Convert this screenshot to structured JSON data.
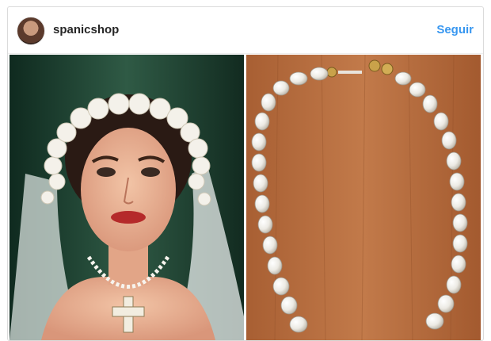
{
  "post": {
    "username": "spanicshop",
    "follow_label": "Seguir"
  },
  "photos": [
    {
      "subject": "bride-with-pearl-necklace"
    },
    {
      "subject": "pearl-necklace-on-wood"
    }
  ],
  "colors": {
    "follow": "#3897f0",
    "username": "#262626",
    "border": "#dbdbdb"
  }
}
